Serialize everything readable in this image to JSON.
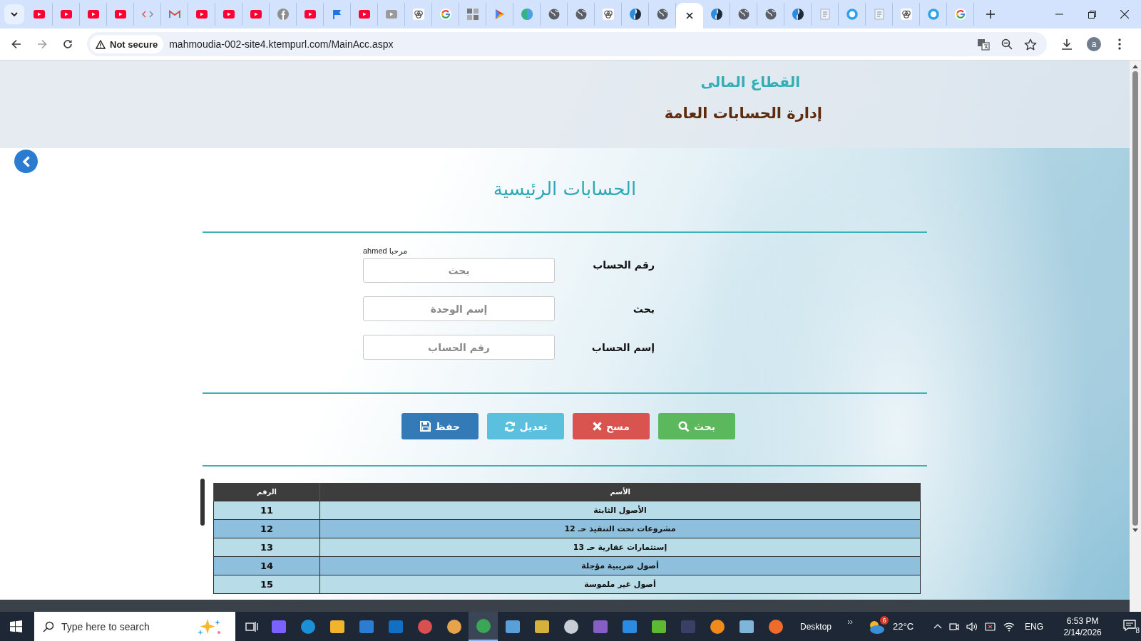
{
  "browser": {
    "tabs": [
      {
        "selected": false
      },
      {
        "selected": false
      },
      {
        "selected": false
      },
      {
        "selected": false
      },
      {
        "selected": false
      },
      {
        "selected": false
      },
      {
        "selected": false
      },
      {
        "selected": false
      },
      {
        "selected": false
      },
      {
        "selected": false
      },
      {
        "selected": false
      },
      {
        "selected": false
      },
      {
        "selected": false
      },
      {
        "selected": false
      },
      {
        "selected": false
      },
      {
        "selected": false
      },
      {
        "selected": false
      },
      {
        "selected": false
      },
      {
        "selected": false
      },
      {
        "selected": false
      },
      {
        "selected": false
      },
      {
        "selected": false
      },
      {
        "selected": false
      },
      {
        "selected": false
      },
      {
        "selected": true
      },
      {
        "selected": false
      },
      {
        "selected": false
      },
      {
        "selected": false
      },
      {
        "selected": false
      },
      {
        "selected": false
      },
      {
        "selected": false
      },
      {
        "selected": false
      },
      {
        "selected": false
      },
      {
        "selected": false
      },
      {
        "selected": false
      }
    ],
    "security_label": "Not secure",
    "url": "mahmoudia-002-site4.ktempurl.com/MainAcc.aspx",
    "profile_initial": "a"
  },
  "header": {
    "sector": "القطاع المالى",
    "department": "إدارة الحسابات العامة"
  },
  "page_title": "الحسابات الرئيسية",
  "greeting": "مرحبا ahmed",
  "form": [
    {
      "label": "رقم الحساب",
      "placeholder": "بحث"
    },
    {
      "label": "بحث",
      "placeholder": "إسم الوحدة"
    },
    {
      "label": "إسم الحساب",
      "placeholder": "رقم الحساب"
    }
  ],
  "buttons": [
    {
      "kind": "search",
      "label": "بحث"
    },
    {
      "kind": "clear",
      "label": "مسح"
    },
    {
      "kind": "edit",
      "label": "تعديل"
    },
    {
      "kind": "save",
      "label": "حفظ"
    }
  ],
  "table": {
    "columns": [
      "الأسم",
      "الرقم"
    ],
    "rows": [
      {
        "name": "الأصول الثابتة",
        "number": "11"
      },
      {
        "name": "مشروعات تحت التنفيذ حـ 12",
        "number": "12"
      },
      {
        "name": "إستثمارات عقارية حـ 13",
        "number": "13"
      },
      {
        "name": "أصول ضريبية مؤجلة",
        "number": "14"
      },
      {
        "name": "أصول غير ملموسة",
        "number": "15"
      }
    ]
  },
  "taskbar": {
    "search_placeholder": "Type here to search",
    "desktop_label": "Desktop",
    "weather_badge": "6",
    "temperature": "22°C",
    "language": "ENG",
    "time": "6:53 PM",
    "date": "2/14/2026",
    "notification_count": "8"
  }
}
